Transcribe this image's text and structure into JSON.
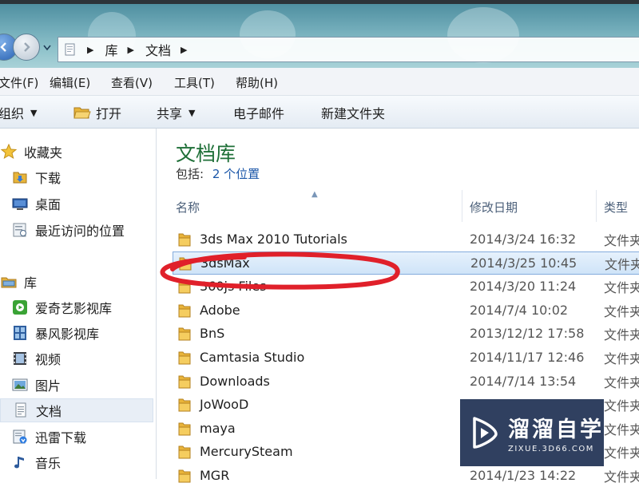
{
  "breadcrumb": {
    "items": [
      "库",
      "文档"
    ]
  },
  "menu": [
    "文件(F)",
    "编辑(E)",
    "查看(V)",
    "工具(T)",
    "帮助(H)"
  ],
  "toolbar": {
    "organize": "组织",
    "open": "打开",
    "share": "共享",
    "email": "电子邮件",
    "new_folder": "新建文件夹"
  },
  "nav": {
    "favorites": {
      "label": "收藏夹",
      "items": [
        "下载",
        "桌面",
        "最近访问的位置"
      ]
    },
    "libraries": {
      "label": "库",
      "items": [
        "爱奇艺影视库",
        "暴风影视库",
        "视频",
        "图片",
        "文档",
        "迅雷下载",
        "音乐"
      ],
      "selected": "文档"
    }
  },
  "library": {
    "title": "文档库",
    "includes_label": "包括:",
    "includes_link": "2 个位置"
  },
  "columns": {
    "name": "名称",
    "modified": "修改日期",
    "type": "类型"
  },
  "files": [
    {
      "name": "3ds Max 2010 Tutorials",
      "modified": "2014/3/24 16:32",
      "type": "文件夹"
    },
    {
      "name": "3dsMax",
      "modified": "2014/3/25 10:45",
      "type": "文件夹"
    },
    {
      "name": "360js Files",
      "modified": "2014/3/20 11:24",
      "type": "文件夹"
    },
    {
      "name": "Adobe",
      "modified": "2014/7/4 10:02",
      "type": "文件夹"
    },
    {
      "name": "BnS",
      "modified": "2013/12/12 17:58",
      "type": "文件夹"
    },
    {
      "name": "Camtasia Studio",
      "modified": "2014/11/17 12:46",
      "type": "文件夹"
    },
    {
      "name": "Downloads",
      "modified": "2014/7/14 13:54",
      "type": "文件夹"
    },
    {
      "name": "JoWooD",
      "modified": "",
      "type": "文件夹"
    },
    {
      "name": "maya",
      "modified": "",
      "type": "文件夹"
    },
    {
      "name": "MercurySteam",
      "modified": "",
      "type": "文件夹"
    },
    {
      "name": "MGR",
      "modified": "2014/1/23 14:22",
      "type": "文件夹"
    }
  ],
  "selected_file": "3dsMax",
  "watermark": {
    "title": "溜溜自学",
    "url": "ZIXUE.3D66.COM"
  },
  "colors": {
    "library_title": "#1e6f37",
    "link": "#1a56a8",
    "selection": "#cfe4f8",
    "annotation": "#e0202a"
  }
}
